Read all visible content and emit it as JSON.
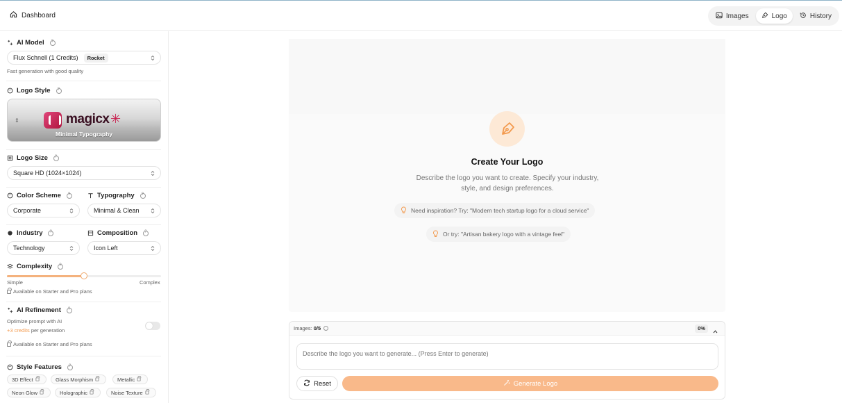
{
  "header": {
    "dashboard_label": "Dashboard",
    "tabs": [
      {
        "label": "Images",
        "icon": "image-icon"
      },
      {
        "label": "Logo",
        "icon": "pen-tool-icon",
        "active": true
      },
      {
        "label": "History",
        "icon": "history-icon"
      }
    ]
  },
  "sidebar": {
    "ai_model": {
      "title": "AI Model",
      "value": "Flux Schnell",
      "credits": "(1 Credits)",
      "badge": "Rocket",
      "hint": "Fast generation with good quality"
    },
    "logo_style": {
      "title": "Logo Style",
      "brand_text": "magicx",
      "caption": "Minimal Typography"
    },
    "logo_size": {
      "title": "Logo Size",
      "value": "Square HD (1024×1024)"
    },
    "color_scheme": {
      "title": "Color Scheme",
      "value": "Corporate"
    },
    "typography": {
      "title": "Typography",
      "value": "Minimal & Clean"
    },
    "industry": {
      "title": "Industry",
      "value": "Technology"
    },
    "composition": {
      "title": "Composition",
      "value": "Icon Left"
    },
    "complexity": {
      "title": "Complexity",
      "min_label": "Simple",
      "max_label": "Complex",
      "level": 0.5,
      "note": "Available on Starter and Pro plans"
    },
    "ai_refinement": {
      "title": "AI Refinement",
      "desc": "Optimize prompt with AI",
      "credits": "+3 credits",
      "credits_suffix": "per generation",
      "enabled": false,
      "note": "Available on Starter and Pro plans"
    },
    "style_features": {
      "title": "Style Features",
      "chips": [
        "3D Effect",
        "Glass Morphism",
        "Metallic",
        "Neon Glow",
        "Holographic",
        "Noise Texture"
      ]
    }
  },
  "main": {
    "title": "Create Your Logo",
    "description": "Describe the logo you want to create. Specify your industry, style, and design preferences.",
    "tip1": "Need inspiration? Try: \"Modern tech startup logo for a cloud service\"",
    "tip2": "Or try: \"Artisan bakery logo with a vintage feel\""
  },
  "composer": {
    "images_label": "Images:",
    "images_count": "0/5",
    "percent": "0%",
    "placeholder": "Describe the logo you want to generate... (Press Enter to generate)",
    "reset_label": "Reset",
    "generate_label": "Generate Logo"
  },
  "colors": {
    "accent": "#f39a4e",
    "accent_soft": "#fde9d6",
    "generate_bg": "#f9b98a"
  }
}
